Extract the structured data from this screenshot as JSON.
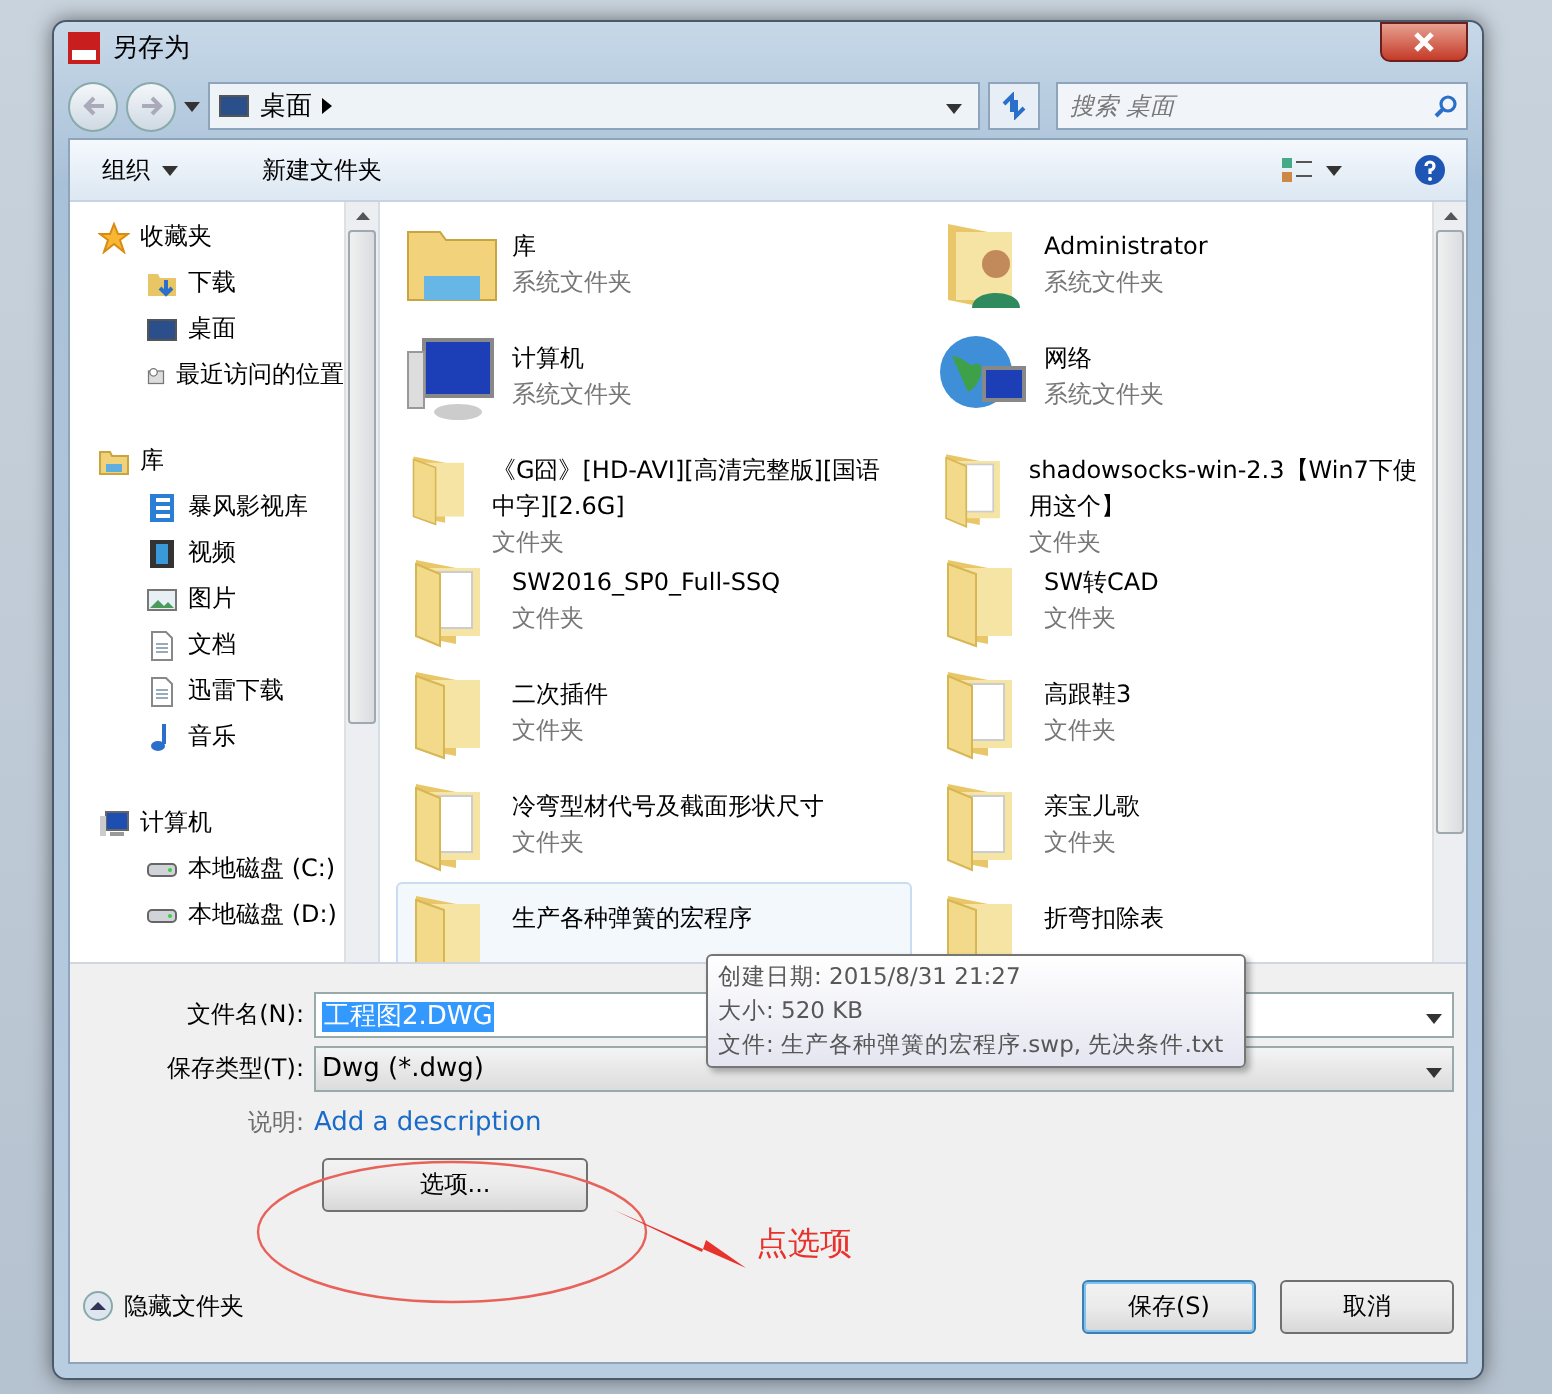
{
  "window": {
    "title": "另存为"
  },
  "address": {
    "location": "桌面",
    "search_placeholder": "搜索 桌面"
  },
  "toolbar": {
    "organize": "组织",
    "new_folder": "新建文件夹"
  },
  "sidebar": [
    {
      "label": "收藏夹",
      "kind": "star",
      "children": [
        {
          "label": "下载",
          "kind": "download"
        },
        {
          "label": "桌面",
          "kind": "desktop"
        },
        {
          "label": "最近访问的位置",
          "kind": "recent"
        }
      ]
    },
    {
      "label": "库",
      "kind": "library",
      "children": [
        {
          "label": "暴风影视库",
          "kind": "media"
        },
        {
          "label": "视频",
          "kind": "video"
        },
        {
          "label": "图片",
          "kind": "picture"
        },
        {
          "label": "文档",
          "kind": "document"
        },
        {
          "label": "迅雷下载",
          "kind": "document"
        },
        {
          "label": "音乐",
          "kind": "music"
        }
      ]
    },
    {
      "label": "计算机",
      "kind": "computer",
      "children": [
        {
          "label": "本地磁盘 (C:)",
          "kind": "drive"
        },
        {
          "label": "本地磁盘 (D:)",
          "kind": "drive"
        }
      ]
    }
  ],
  "files": [
    {
      "name": "库",
      "type": "系统文件夹",
      "kind": "library",
      "selected": false
    },
    {
      "name": "Administrator",
      "type": "系统文件夹",
      "kind": "user",
      "selected": false
    },
    {
      "name": "计算机",
      "type": "系统文件夹",
      "kind": "computer",
      "selected": false
    },
    {
      "name": "网络",
      "type": "系统文件夹",
      "kind": "network",
      "selected": false
    },
    {
      "name": "《G囧》[HD-AVI][高清完整版][国语中字][2.6G]",
      "type": "文件夹",
      "kind": "folder",
      "selected": false
    },
    {
      "name": "shadowsocks-win-2.3【Win7下使用这个】",
      "type": "文件夹",
      "kind": "docfolder",
      "selected": false
    },
    {
      "name": "SW2016_SP0_Full-SSQ",
      "type": "文件夹",
      "kind": "docfolder",
      "selected": false
    },
    {
      "name": "SW转CAD",
      "type": "文件夹",
      "kind": "folder",
      "selected": false
    },
    {
      "name": "二次插件",
      "type": "文件夹",
      "kind": "folder",
      "selected": false
    },
    {
      "name": "高跟鞋3",
      "type": "文件夹",
      "kind": "docfolder",
      "selected": false
    },
    {
      "name": "冷弯型材代号及截面形状尺寸",
      "type": "文件夹",
      "kind": "docfolder",
      "selected": false
    },
    {
      "name": "亲宝儿歌",
      "type": "文件夹",
      "kind": "docfolder",
      "selected": false
    },
    {
      "name": "生产各种弹簧的宏程序",
      "kind": "folder",
      "selected": true
    },
    {
      "name": "折弯扣除表",
      "kind": "folder",
      "selected": false
    }
  ],
  "tooltip": [
    "创建日期: 2015/8/31 21:27",
    "大小: 520 KB",
    "文件: 生产各种弹簧的宏程序.swp, 先决条件.txt"
  ],
  "form": {
    "filename_label": "文件名(N):",
    "filename": "工程图2.DWG",
    "type_label": "保存类型(T):",
    "type": "Dwg (*.dwg)",
    "description_label": "说明:",
    "description_link": "Add a description",
    "options_button": "选项..."
  },
  "hide_folders": "隐藏文件夹",
  "buttons": {
    "save": "保存(S)",
    "cancel": "取消"
  },
  "annotation": {
    "text": "点选项"
  }
}
